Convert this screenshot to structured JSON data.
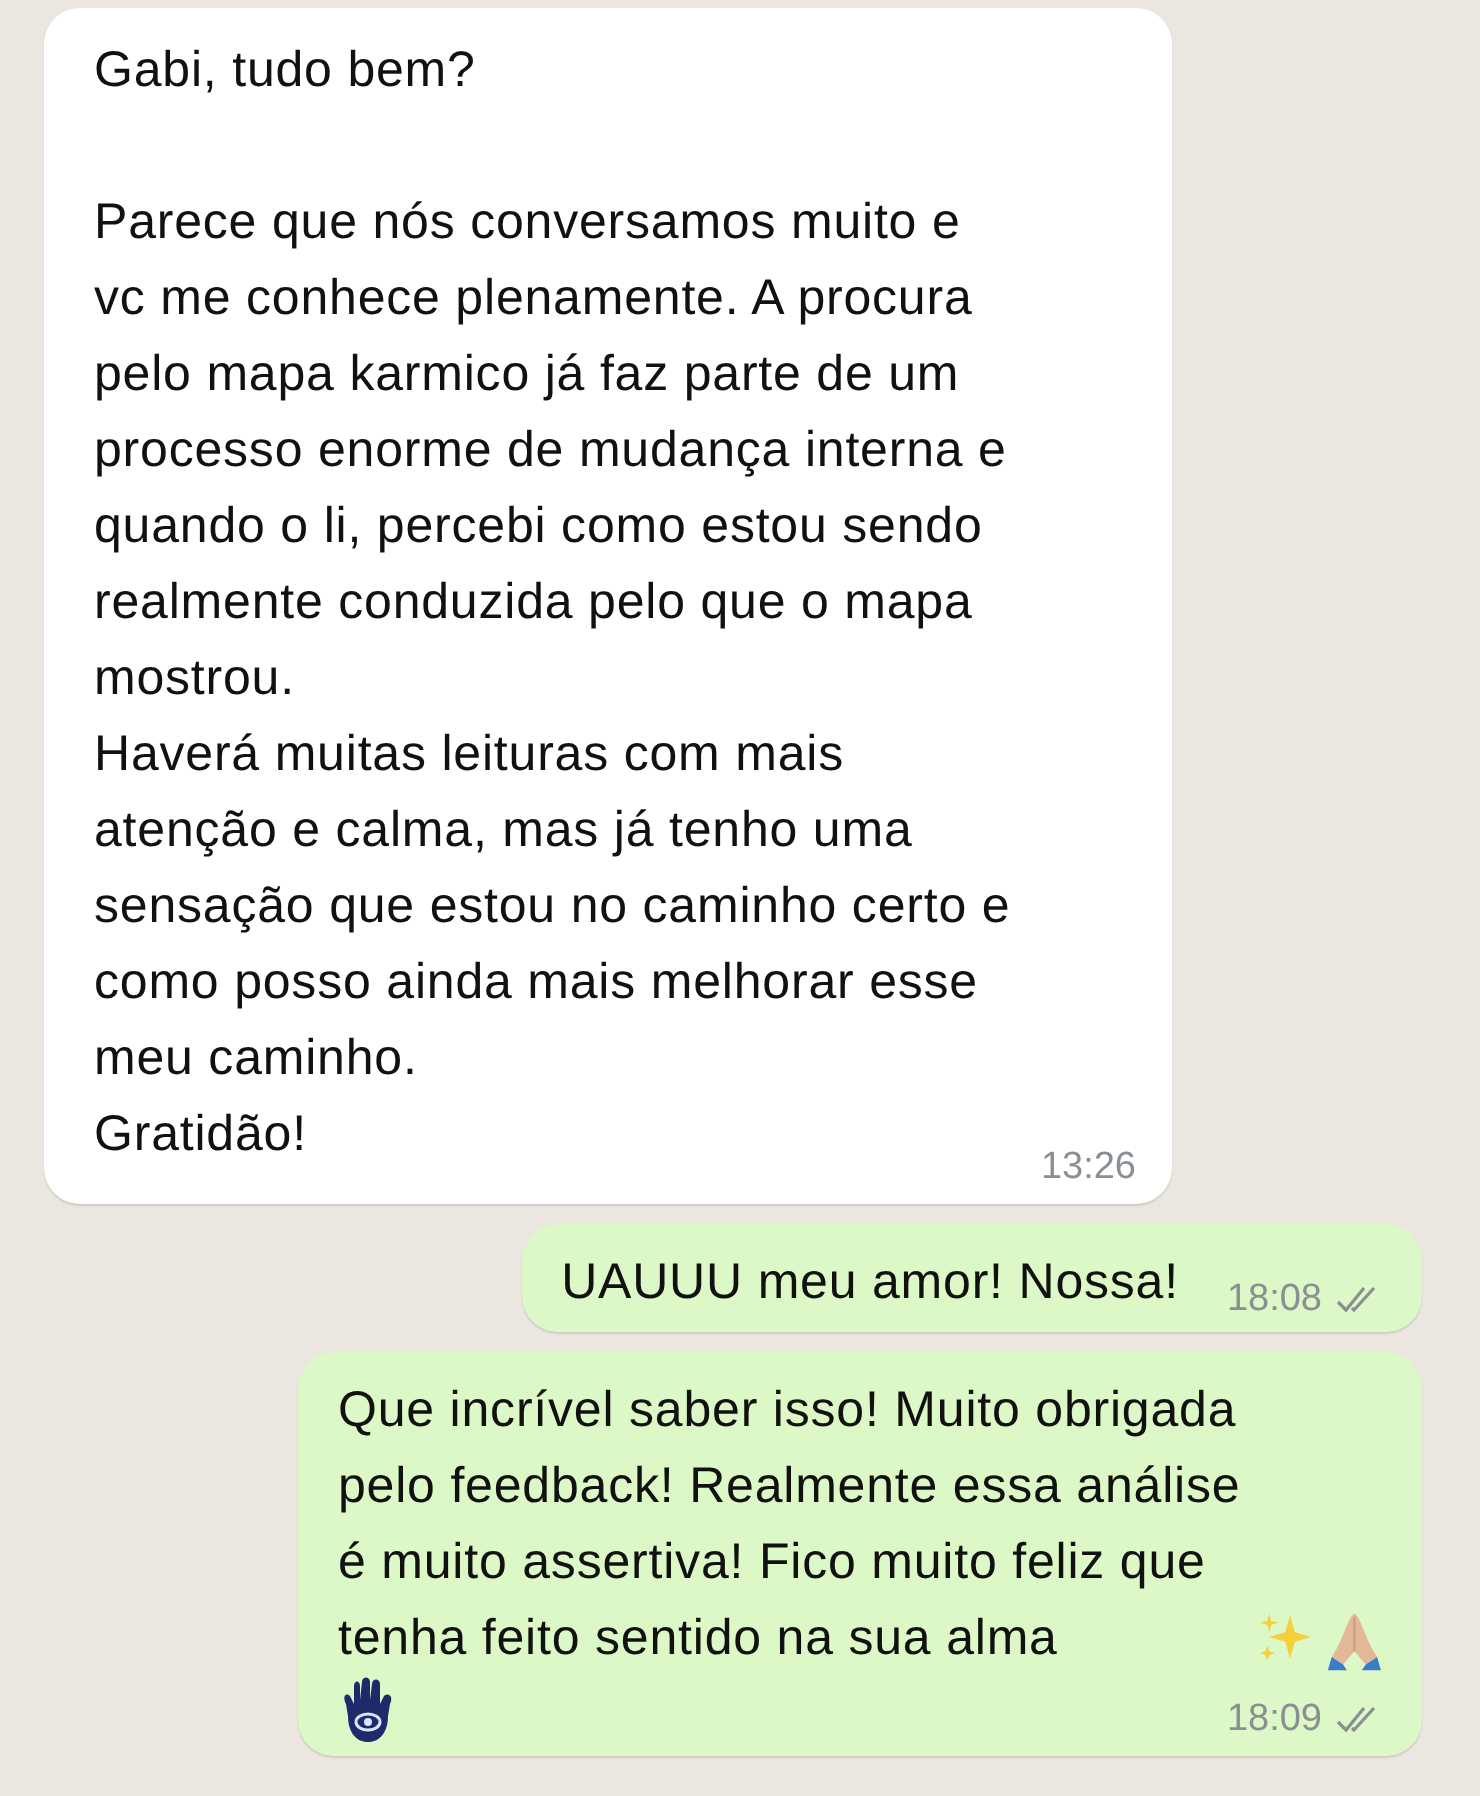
{
  "messages": [
    {
      "kind": "incoming",
      "text": "Gabi, tudo bem?\n\nParece que nós conversamos muito e\nvc me conhece plenamente. A procura\npelo mapa karmico já faz parte de um\nprocesso enorme de mudança interna e\nquando o li, percebi como estou sendo\nrealmente conduzida pelo que o mapa\nmostrou.\nHaverá muitas leituras com mais\natenção e calma, mas já tenho uma\nsensação que estou no caminho certo e\ncomo posso ainda mais melhorar esse\nmeu caminho.\nGratidão!",
      "time": "13:26"
    },
    {
      "kind": "outgoing",
      "text": "UAUUU meu amor! Nossa!",
      "time": "18:08",
      "read": false
    },
    {
      "kind": "emojireply",
      "text": "Que incrível saber isso! Muito obrigada\npelo feedback! Realmente essa análise\né muito assertiva! Fico muito feliz que\ntenha feito sentido na sua alma",
      "time": "18:09",
      "read": false
    }
  ]
}
